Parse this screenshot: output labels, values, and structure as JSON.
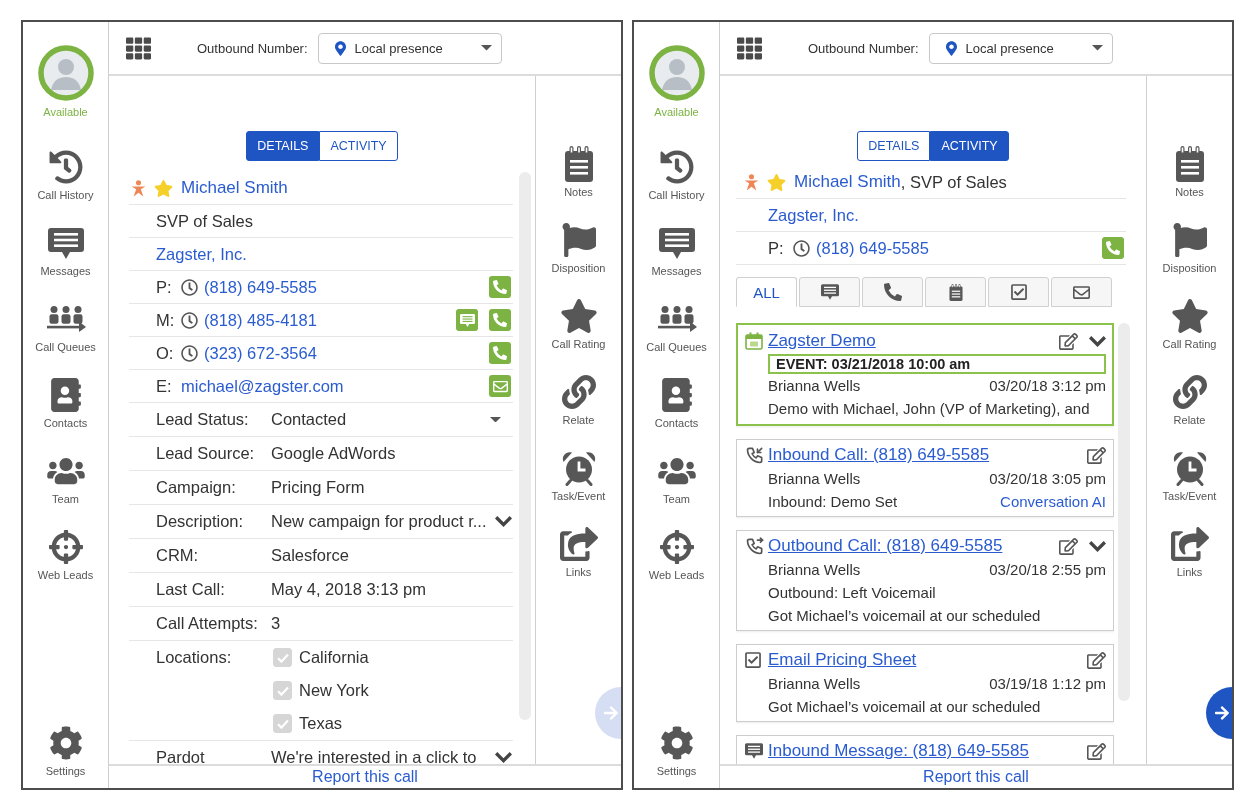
{
  "panels": [
    {
      "kind": "details",
      "agent": {
        "status": "Available"
      },
      "nav": [
        {
          "kind": "history",
          "label": "Call History"
        },
        {
          "kind": "messages",
          "label": "Messages"
        },
        {
          "kind": "queues",
          "label": "Call Queues"
        },
        {
          "kind": "contacts",
          "label": "Contacts"
        },
        {
          "kind": "team",
          "label": "Team"
        },
        {
          "kind": "web_leads",
          "label": "Web Leads"
        }
      ],
      "settings": {
        "label": "Settings"
      },
      "outbound": {
        "label": "Outbound Number:",
        "value": "Local presence"
      },
      "tabs": [
        {
          "label": "DETAILS",
          "selected": true
        },
        {
          "label": "ACTIVITY",
          "selected": false
        }
      ],
      "contact": {
        "name": "Michael Smith",
        "title": "SVP of Sales",
        "company": "Zagster, Inc.",
        "phones": [
          {
            "label": "P:",
            "number": "(818) 649-5585",
            "text_button": false
          },
          {
            "label": "M:",
            "number": "(818) 485-4181",
            "text_button": true
          },
          {
            "label": "O:",
            "number": "(323) 672-3564",
            "text_button": false
          }
        ],
        "email": {
          "label": "E:",
          "value": "michael@zagster.com"
        },
        "fields": [
          {
            "kind": "dropdown",
            "label": "Lead Status:",
            "value": "Contacted"
          },
          {
            "kind": "text",
            "label": "Lead Source:",
            "value": "Google AdWords"
          },
          {
            "kind": "text",
            "label": "Campaign:",
            "value": "Pricing Form"
          },
          {
            "kind": "expandable",
            "label": "Description:",
            "value": "New campaign for product r..."
          },
          {
            "kind": "text",
            "label": "CRM:",
            "value": "Salesforce"
          },
          {
            "kind": "text",
            "label": "Last Call:",
            "value": "May 4, 2018 3:13 pm"
          },
          {
            "kind": "text",
            "label": "Call Attempts:",
            "value": "3"
          },
          {
            "kind": "checklist",
            "label": "Locations:",
            "options": [
              {
                "label": "California",
                "checked": true
              },
              {
                "label": "New York",
                "checked": true
              },
              {
                "label": "Texas",
                "checked": true
              }
            ]
          },
          {
            "kind": "expandable",
            "label": "Pardot",
            "value": "We're interested in a click to"
          }
        ]
      },
      "actions": [
        {
          "kind": "notes",
          "label": "Notes"
        },
        {
          "kind": "disposition",
          "label": "Disposition"
        },
        {
          "kind": "rating",
          "label": "Call Rating"
        },
        {
          "kind": "relate",
          "label": "Relate"
        },
        {
          "kind": "task",
          "label": "Task/Event"
        },
        {
          "kind": "links",
          "label": "Links"
        }
      ],
      "footer_link": "Report this call",
      "next_button": {
        "disabled": true
      }
    },
    {
      "kind": "activity",
      "agent": {
        "status": "Available"
      },
      "nav": [
        {
          "kind": "history",
          "label": "Call History"
        },
        {
          "kind": "messages",
          "label": "Messages"
        },
        {
          "kind": "queues",
          "label": "Call Queues"
        },
        {
          "kind": "contacts",
          "label": "Contacts"
        },
        {
          "kind": "team",
          "label": "Team"
        },
        {
          "kind": "web_leads",
          "label": "Web Leads"
        }
      ],
      "settings": {
        "label": "Settings"
      },
      "outbound": {
        "label": "Outbound Number:",
        "value": "Local presence"
      },
      "tabs": [
        {
          "label": "DETAILS",
          "selected": false
        },
        {
          "label": "ACTIVITY",
          "selected": true
        }
      ],
      "contact": {
        "name": "Michael Smith",
        "title": ", SVP of Sales",
        "company": "Zagster, Inc.",
        "phones": [
          {
            "label": "P:",
            "number": "(818) 649-5585",
            "text_button": false
          }
        ]
      },
      "filters": [
        {
          "kind": "all",
          "label": "ALL",
          "selected": true
        },
        {
          "kind": "message",
          "selected": false
        },
        {
          "kind": "call",
          "selected": false
        },
        {
          "kind": "note",
          "selected": false
        },
        {
          "kind": "task",
          "selected": false
        },
        {
          "kind": "email",
          "selected": false
        }
      ],
      "activities": [
        {
          "kind": "event",
          "title": "Zagster Demo",
          "highlighted": true,
          "expandable": true,
          "event": "EVENT: 03/21/2018 10:00 am",
          "user": "Brianna Wells",
          "time": "03/20/18 3:12 pm",
          "lines": [
            "Demo with Michael, John (VP of Marketing), and"
          ]
        },
        {
          "kind": "inbound_call",
          "title": "Inbound Call: (818) 649-5585",
          "highlighted": false,
          "expandable": false,
          "user": "Brianna Wells",
          "time": "03/20/18 3:05 pm",
          "lines": [
            "Inbound: Demo Set"
          ],
          "link": "Conversation AI"
        },
        {
          "kind": "outbound_call",
          "title": "Outbound Call: (818) 649-5585",
          "highlighted": false,
          "expandable": true,
          "user": "Brianna Wells",
          "time": "03/20/18 2:55 pm",
          "lines": [
            "Outbound: Left Voicemail",
            "Got Michael’s voicemail at our scheduled"
          ]
        },
        {
          "kind": "task",
          "title": "Email Pricing Sheet",
          "highlighted": false,
          "expandable": false,
          "user": "Brianna Wells",
          "time": "03/19/18 1:12 pm",
          "lines": [
            "Got Michael’s voicemail at our scheduled"
          ]
        },
        {
          "kind": "message",
          "title": "Inbound Message: (818) 649-5585",
          "highlighted": false,
          "expandable": false
        }
      ],
      "actions": [
        {
          "kind": "notes",
          "label": "Notes"
        },
        {
          "kind": "disposition",
          "label": "Disposition"
        },
        {
          "kind": "rating",
          "label": "Call Rating"
        },
        {
          "kind": "relate",
          "label": "Relate"
        },
        {
          "kind": "task",
          "label": "Task/Event"
        },
        {
          "kind": "links",
          "label": "Links"
        }
      ],
      "footer_link": "Report this call",
      "next_button": {
        "disabled": false
      }
    }
  ]
}
